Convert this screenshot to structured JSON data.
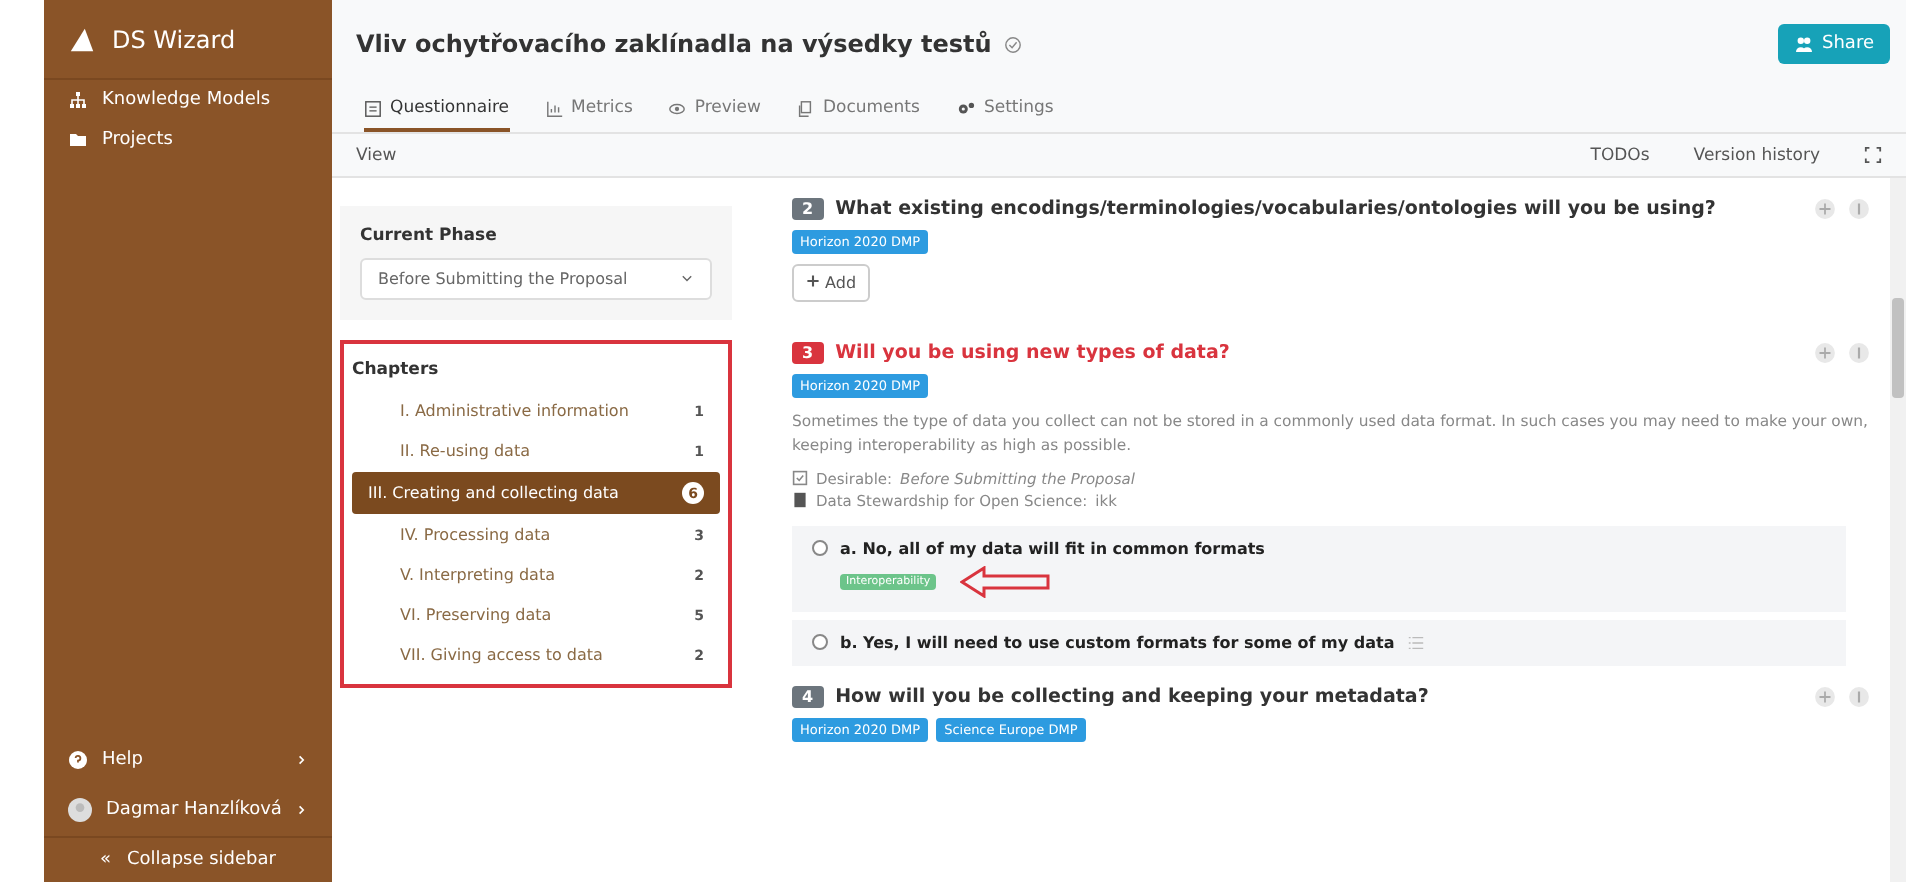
{
  "sidebar": {
    "brand": "DS Wizard",
    "items": [
      {
        "label": "Knowledge Models"
      },
      {
        "label": "Projects"
      }
    ],
    "bottom": [
      {
        "label": "Help"
      },
      {
        "label": "Dagmar Hanzlíková"
      }
    ],
    "collapse": {
      "icon": "«",
      "label": "Collapse sidebar"
    }
  },
  "header": {
    "title": "Vliv ochytřovacího zaklínadla na výsedky testů",
    "share": "Share"
  },
  "tabs": [
    {
      "label": "Questionnaire",
      "selected": true
    },
    {
      "label": "Metrics",
      "selected": false
    },
    {
      "label": "Preview",
      "selected": false
    },
    {
      "label": "Documents",
      "selected": false
    },
    {
      "label": "Settings",
      "selected": false
    }
  ],
  "toolbar": {
    "view": "View",
    "todos": "TODOs",
    "history": "Version history"
  },
  "phase": {
    "label": "Current Phase",
    "value": "Before Submitting the Proposal"
  },
  "chapters": {
    "title": "Chapters",
    "items": [
      {
        "label": "I. Administrative information",
        "count": "1",
        "selected": false
      },
      {
        "label": "II. Re-using data",
        "count": "1",
        "selected": false
      },
      {
        "label": "III. Creating and collecting data",
        "count": "6",
        "selected": true
      },
      {
        "label": "IV. Processing data",
        "count": "3",
        "selected": false
      },
      {
        "label": "V. Interpreting data",
        "count": "2",
        "selected": false
      },
      {
        "label": "VI. Preserving data",
        "count": "5",
        "selected": false
      },
      {
        "label": "VII. Giving access to data",
        "count": "2",
        "selected": false
      }
    ]
  },
  "questions": [
    {
      "number": "2",
      "title": "What existing encodings/terminologies/vocabularies/ontologies will you be using?",
      "highlighted": false,
      "tags": [
        "Horizon 2020 DMP"
      ],
      "add": "Add"
    },
    {
      "number": "3",
      "title": "Will you be using new types of data?",
      "highlighted": true,
      "tags": [
        "Horizon 2020 DMP"
      ],
      "description": "Sometimes the type of data you collect can not be stored in a commonly used data format. In such cases you may need to make your own, keeping interoperability as high as possible.",
      "desirable_label": "Desirable:",
      "desirable_value": "Before Submitting the Proposal",
      "book_label": "Data Stewardship for Open Science:",
      "book_link": "ikk",
      "answers": [
        {
          "label": "a. No, all of my data will fit in common formats",
          "selected": false,
          "badge": "Interoperability",
          "follow_up": false
        },
        {
          "label": "b. Yes, I will need to use custom formats for some of my data",
          "selected": false,
          "follow_up": true
        }
      ]
    },
    {
      "number": "4",
      "title": "How will you be collecting and keeping your metadata?",
      "highlighted": false,
      "tags": [
        "Horizon 2020 DMP",
        "Science Europe DMP"
      ]
    }
  ]
}
